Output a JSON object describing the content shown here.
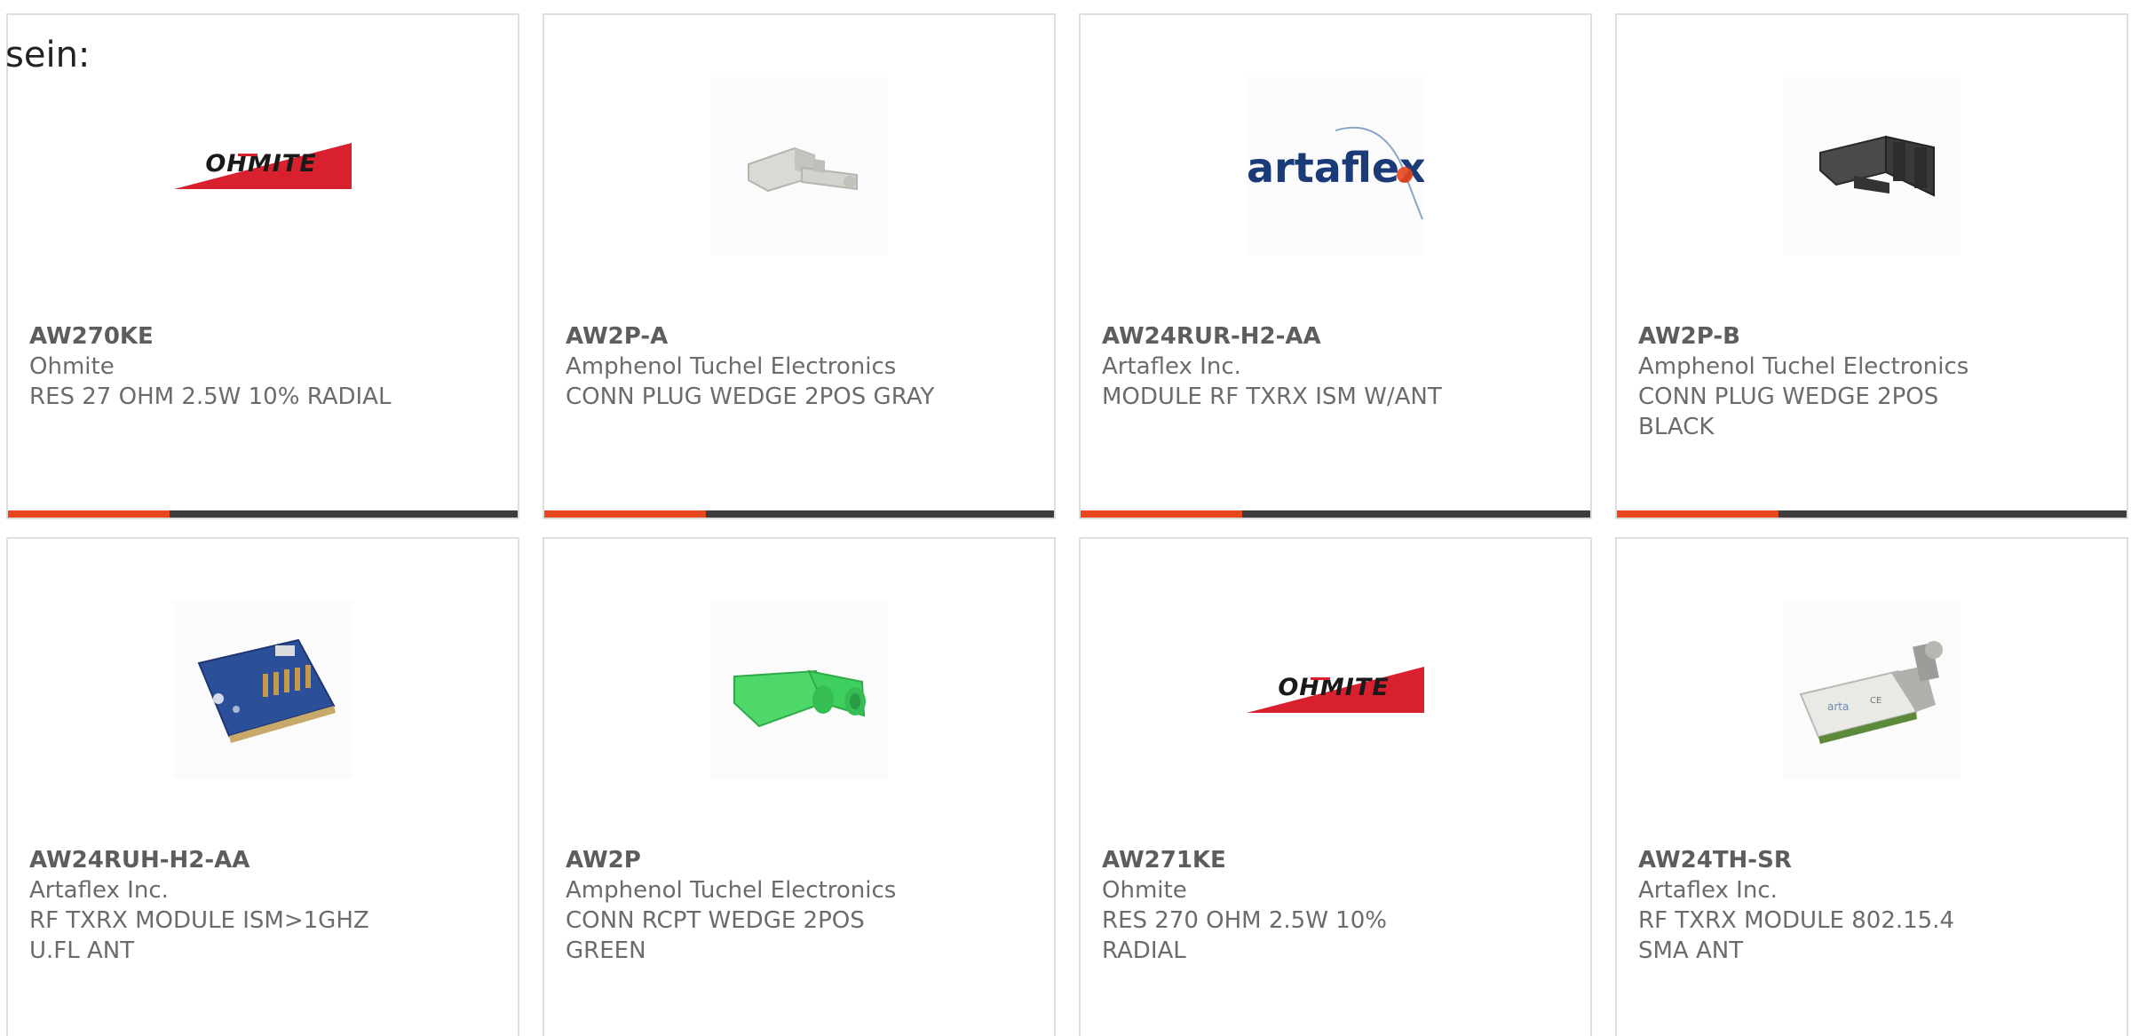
{
  "intro_text": "sein:",
  "colors": {
    "accent": "#e8461c",
    "bar_dark": "#3c3c3c",
    "border": "#dedede",
    "text": "#6b6b6b"
  },
  "products": [
    {
      "part_number": "AW270KE",
      "manufacturer": "Ohmite",
      "description": "RES 27 OHM 2.5W 10% RADIAL",
      "image": "ohmite-logo"
    },
    {
      "part_number": "AW2P-A",
      "manufacturer": "Amphenol Tuchel Electronics",
      "description": "CONN PLUG WEDGE 2POS GRAY",
      "image": "gray-wedge-plug"
    },
    {
      "part_number": "AW24RUR-H2-AA",
      "manufacturer": "Artaflex Inc.",
      "description": "MODULE RF TXRX ISM W/ANT",
      "image": "artaflex-logo",
      "logo_text": "artaflex"
    },
    {
      "part_number": "AW2P-B",
      "manufacturer": "Amphenol Tuchel Electronics",
      "description": "CONN PLUG WEDGE 2POS BLACK",
      "image": "black-wedge-plug"
    },
    {
      "part_number": "AW24RUH-H2-AA",
      "manufacturer": "Artaflex Inc.",
      "description": "RF TXRX MODULE ISM>1GHZ U.FL ANT",
      "image": "rf-module-board"
    },
    {
      "part_number": "AW2P",
      "manufacturer": "Amphenol Tuchel Electronics",
      "description": "CONN RCPT WEDGE 2POS GREEN",
      "image": "green-wedge-receptacle"
    },
    {
      "part_number": "AW271KE",
      "manufacturer": "Ohmite",
      "description": "RES 270 OHM 2.5W 10% RADIAL",
      "image": "ohmite-logo"
    },
    {
      "part_number": "AW24TH-SR",
      "manufacturer": "Artaflex Inc.",
      "description": "RF TXRX MODULE 802.15.4 SMA ANT",
      "image": "rf-module-sma"
    }
  ]
}
